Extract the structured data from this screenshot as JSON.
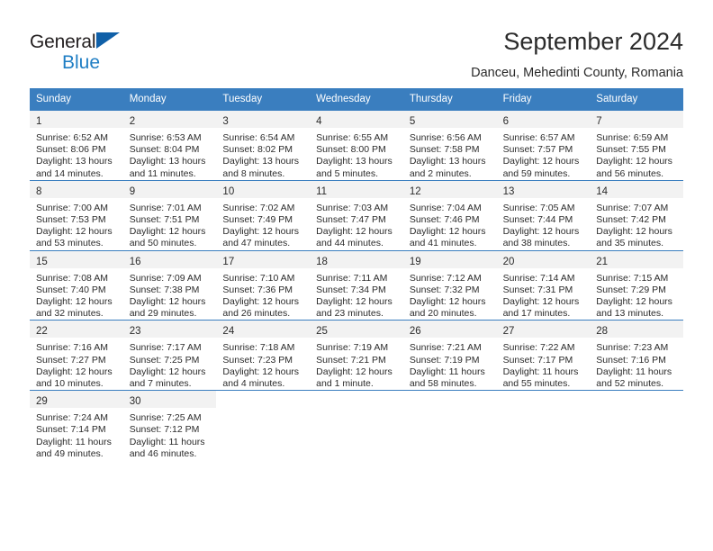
{
  "logo": {
    "part1": "General",
    "part2": "Blue",
    "triangle_color": "#1060a8",
    "blue_color": "#1f7ec4"
  },
  "header": {
    "title": "September 2024",
    "subtitle": "Danceu, Mehedinti County, Romania"
  },
  "colors": {
    "header_bg": "#3a7ebf",
    "header_text": "#ffffff",
    "daynum_band": "#f2f2f2",
    "text": "#2b2b2b"
  },
  "weekdays": [
    "Sunday",
    "Monday",
    "Tuesday",
    "Wednesday",
    "Thursday",
    "Friday",
    "Saturday"
  ],
  "weeks": [
    [
      {
        "day": "1",
        "lines": [
          "Sunrise: 6:52 AM",
          "Sunset: 8:06 PM",
          "Daylight: 13 hours",
          "and 14 minutes."
        ]
      },
      {
        "day": "2",
        "lines": [
          "Sunrise: 6:53 AM",
          "Sunset: 8:04 PM",
          "Daylight: 13 hours",
          "and 11 minutes."
        ]
      },
      {
        "day": "3",
        "lines": [
          "Sunrise: 6:54 AM",
          "Sunset: 8:02 PM",
          "Daylight: 13 hours",
          "and 8 minutes."
        ]
      },
      {
        "day": "4",
        "lines": [
          "Sunrise: 6:55 AM",
          "Sunset: 8:00 PM",
          "Daylight: 13 hours",
          "and 5 minutes."
        ]
      },
      {
        "day": "5",
        "lines": [
          "Sunrise: 6:56 AM",
          "Sunset: 7:58 PM",
          "Daylight: 13 hours",
          "and 2 minutes."
        ]
      },
      {
        "day": "6",
        "lines": [
          "Sunrise: 6:57 AM",
          "Sunset: 7:57 PM",
          "Daylight: 12 hours",
          "and 59 minutes."
        ]
      },
      {
        "day": "7",
        "lines": [
          "Sunrise: 6:59 AM",
          "Sunset: 7:55 PM",
          "Daylight: 12 hours",
          "and 56 minutes."
        ]
      }
    ],
    [
      {
        "day": "8",
        "lines": [
          "Sunrise: 7:00 AM",
          "Sunset: 7:53 PM",
          "Daylight: 12 hours",
          "and 53 minutes."
        ]
      },
      {
        "day": "9",
        "lines": [
          "Sunrise: 7:01 AM",
          "Sunset: 7:51 PM",
          "Daylight: 12 hours",
          "and 50 minutes."
        ]
      },
      {
        "day": "10",
        "lines": [
          "Sunrise: 7:02 AM",
          "Sunset: 7:49 PM",
          "Daylight: 12 hours",
          "and 47 minutes."
        ]
      },
      {
        "day": "11",
        "lines": [
          "Sunrise: 7:03 AM",
          "Sunset: 7:47 PM",
          "Daylight: 12 hours",
          "and 44 minutes."
        ]
      },
      {
        "day": "12",
        "lines": [
          "Sunrise: 7:04 AM",
          "Sunset: 7:46 PM",
          "Daylight: 12 hours",
          "and 41 minutes."
        ]
      },
      {
        "day": "13",
        "lines": [
          "Sunrise: 7:05 AM",
          "Sunset: 7:44 PM",
          "Daylight: 12 hours",
          "and 38 minutes."
        ]
      },
      {
        "day": "14",
        "lines": [
          "Sunrise: 7:07 AM",
          "Sunset: 7:42 PM",
          "Daylight: 12 hours",
          "and 35 minutes."
        ]
      }
    ],
    [
      {
        "day": "15",
        "lines": [
          "Sunrise: 7:08 AM",
          "Sunset: 7:40 PM",
          "Daylight: 12 hours",
          "and 32 minutes."
        ]
      },
      {
        "day": "16",
        "lines": [
          "Sunrise: 7:09 AM",
          "Sunset: 7:38 PM",
          "Daylight: 12 hours",
          "and 29 minutes."
        ]
      },
      {
        "day": "17",
        "lines": [
          "Sunrise: 7:10 AM",
          "Sunset: 7:36 PM",
          "Daylight: 12 hours",
          "and 26 minutes."
        ]
      },
      {
        "day": "18",
        "lines": [
          "Sunrise: 7:11 AM",
          "Sunset: 7:34 PM",
          "Daylight: 12 hours",
          "and 23 minutes."
        ]
      },
      {
        "day": "19",
        "lines": [
          "Sunrise: 7:12 AM",
          "Sunset: 7:32 PM",
          "Daylight: 12 hours",
          "and 20 minutes."
        ]
      },
      {
        "day": "20",
        "lines": [
          "Sunrise: 7:14 AM",
          "Sunset: 7:31 PM",
          "Daylight: 12 hours",
          "and 17 minutes."
        ]
      },
      {
        "day": "21",
        "lines": [
          "Sunrise: 7:15 AM",
          "Sunset: 7:29 PM",
          "Daylight: 12 hours",
          "and 13 minutes."
        ]
      }
    ],
    [
      {
        "day": "22",
        "lines": [
          "Sunrise: 7:16 AM",
          "Sunset: 7:27 PM",
          "Daylight: 12 hours",
          "and 10 minutes."
        ]
      },
      {
        "day": "23",
        "lines": [
          "Sunrise: 7:17 AM",
          "Sunset: 7:25 PM",
          "Daylight: 12 hours",
          "and 7 minutes."
        ]
      },
      {
        "day": "24",
        "lines": [
          "Sunrise: 7:18 AM",
          "Sunset: 7:23 PM",
          "Daylight: 12 hours",
          "and 4 minutes."
        ]
      },
      {
        "day": "25",
        "lines": [
          "Sunrise: 7:19 AM",
          "Sunset: 7:21 PM",
          "Daylight: 12 hours",
          "and 1 minute."
        ]
      },
      {
        "day": "26",
        "lines": [
          "Sunrise: 7:21 AM",
          "Sunset: 7:19 PM",
          "Daylight: 11 hours",
          "and 58 minutes."
        ]
      },
      {
        "day": "27",
        "lines": [
          "Sunrise: 7:22 AM",
          "Sunset: 7:17 PM",
          "Daylight: 11 hours",
          "and 55 minutes."
        ]
      },
      {
        "day": "28",
        "lines": [
          "Sunrise: 7:23 AM",
          "Sunset: 7:16 PM",
          "Daylight: 11 hours",
          "and 52 minutes."
        ]
      }
    ],
    [
      {
        "day": "29",
        "lines": [
          "Sunrise: 7:24 AM",
          "Sunset: 7:14 PM",
          "Daylight: 11 hours",
          "and 49 minutes."
        ]
      },
      {
        "day": "30",
        "lines": [
          "Sunrise: 7:25 AM",
          "Sunset: 7:12 PM",
          "Daylight: 11 hours",
          "and 46 minutes."
        ]
      },
      {
        "day": "",
        "lines": []
      },
      {
        "day": "",
        "lines": []
      },
      {
        "day": "",
        "lines": []
      },
      {
        "day": "",
        "lines": []
      },
      {
        "day": "",
        "lines": []
      }
    ]
  ]
}
